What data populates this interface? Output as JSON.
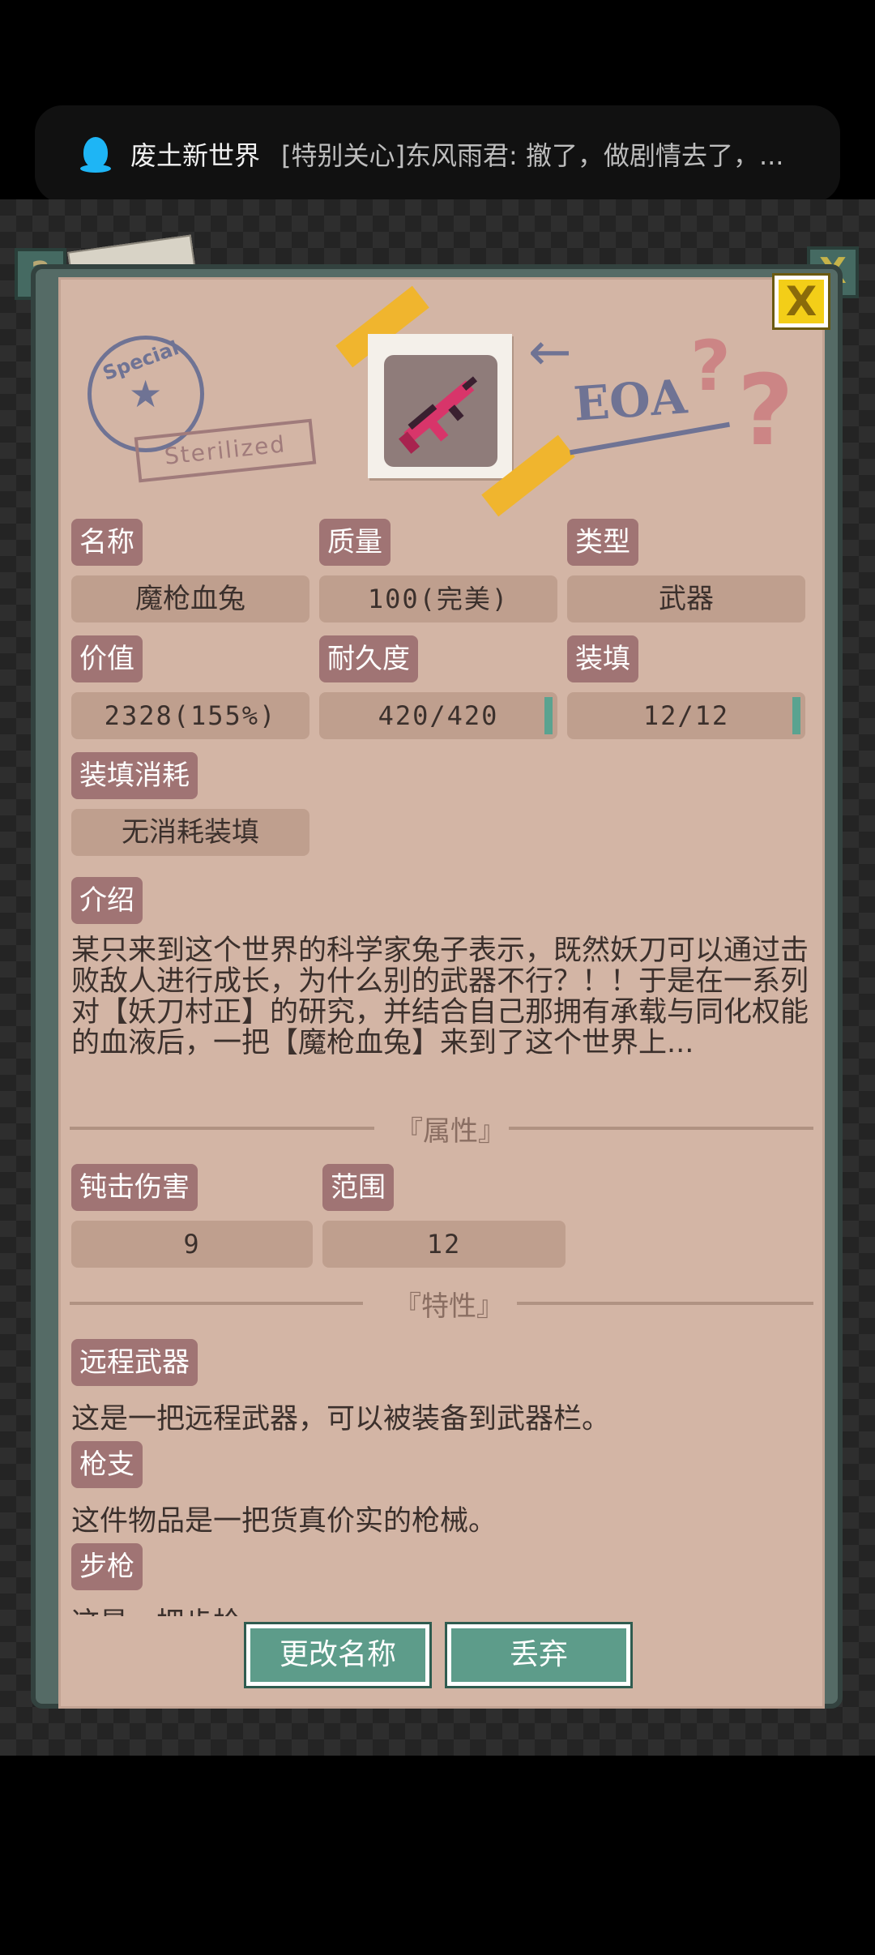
{
  "notification": {
    "app_name": "废土新世界",
    "message": "[特别关心]东风雨君: 撤了，做剧情去了，..."
  },
  "decor": {
    "help_glyph": "?",
    "close_glyph": "X",
    "stamp_text": "Special",
    "stamp_star": "★",
    "sterilized": "Sterilized",
    "eoa": "EOA",
    "arrow": "←",
    "question_mark": "?"
  },
  "fields": {
    "name": {
      "label": "名称",
      "value": "魔枪血兔"
    },
    "quality": {
      "label": "质量",
      "value": "100(完美)"
    },
    "type": {
      "label": "类型",
      "value": "武器"
    },
    "worth": {
      "label": "价值",
      "value": "2328(155%)"
    },
    "durability": {
      "label": "耐久度",
      "value": "420/420"
    },
    "ammo": {
      "label": "装填",
      "value": "12/12"
    },
    "ammo_cost": {
      "label": "装填消耗",
      "value": "无消耗装填"
    }
  },
  "intro": {
    "label": "介绍",
    "text": "某只来到这个世界的科学家兔子表示，既然妖刀可以通过击败敌人进行成长，为什么别的武器不行？！！于是在一系列对【妖刀村正】的研究，并结合自己那拥有承载与同化权能的血液后，一把【魔枪血兔】来到了这个世界上...",
    "more": "..."
  },
  "attributes": {
    "header": "『属性』",
    "blunt": {
      "label": "钝击伤害",
      "value": "9"
    },
    "range": {
      "label": "范围",
      "value": "12"
    }
  },
  "traits": {
    "header": "『特性』",
    "items": [
      {
        "label": "远程武器",
        "text": "这是一把远程武器，可以被装备到武器栏。"
      },
      {
        "label": "枪支",
        "text": "这件物品是一把货真价实的枪械。"
      },
      {
        "label": "步枪",
        "text": "这是一把步枪"
      }
    ]
  },
  "buttons": {
    "rename": "更改名称",
    "discard": "丢弃"
  }
}
